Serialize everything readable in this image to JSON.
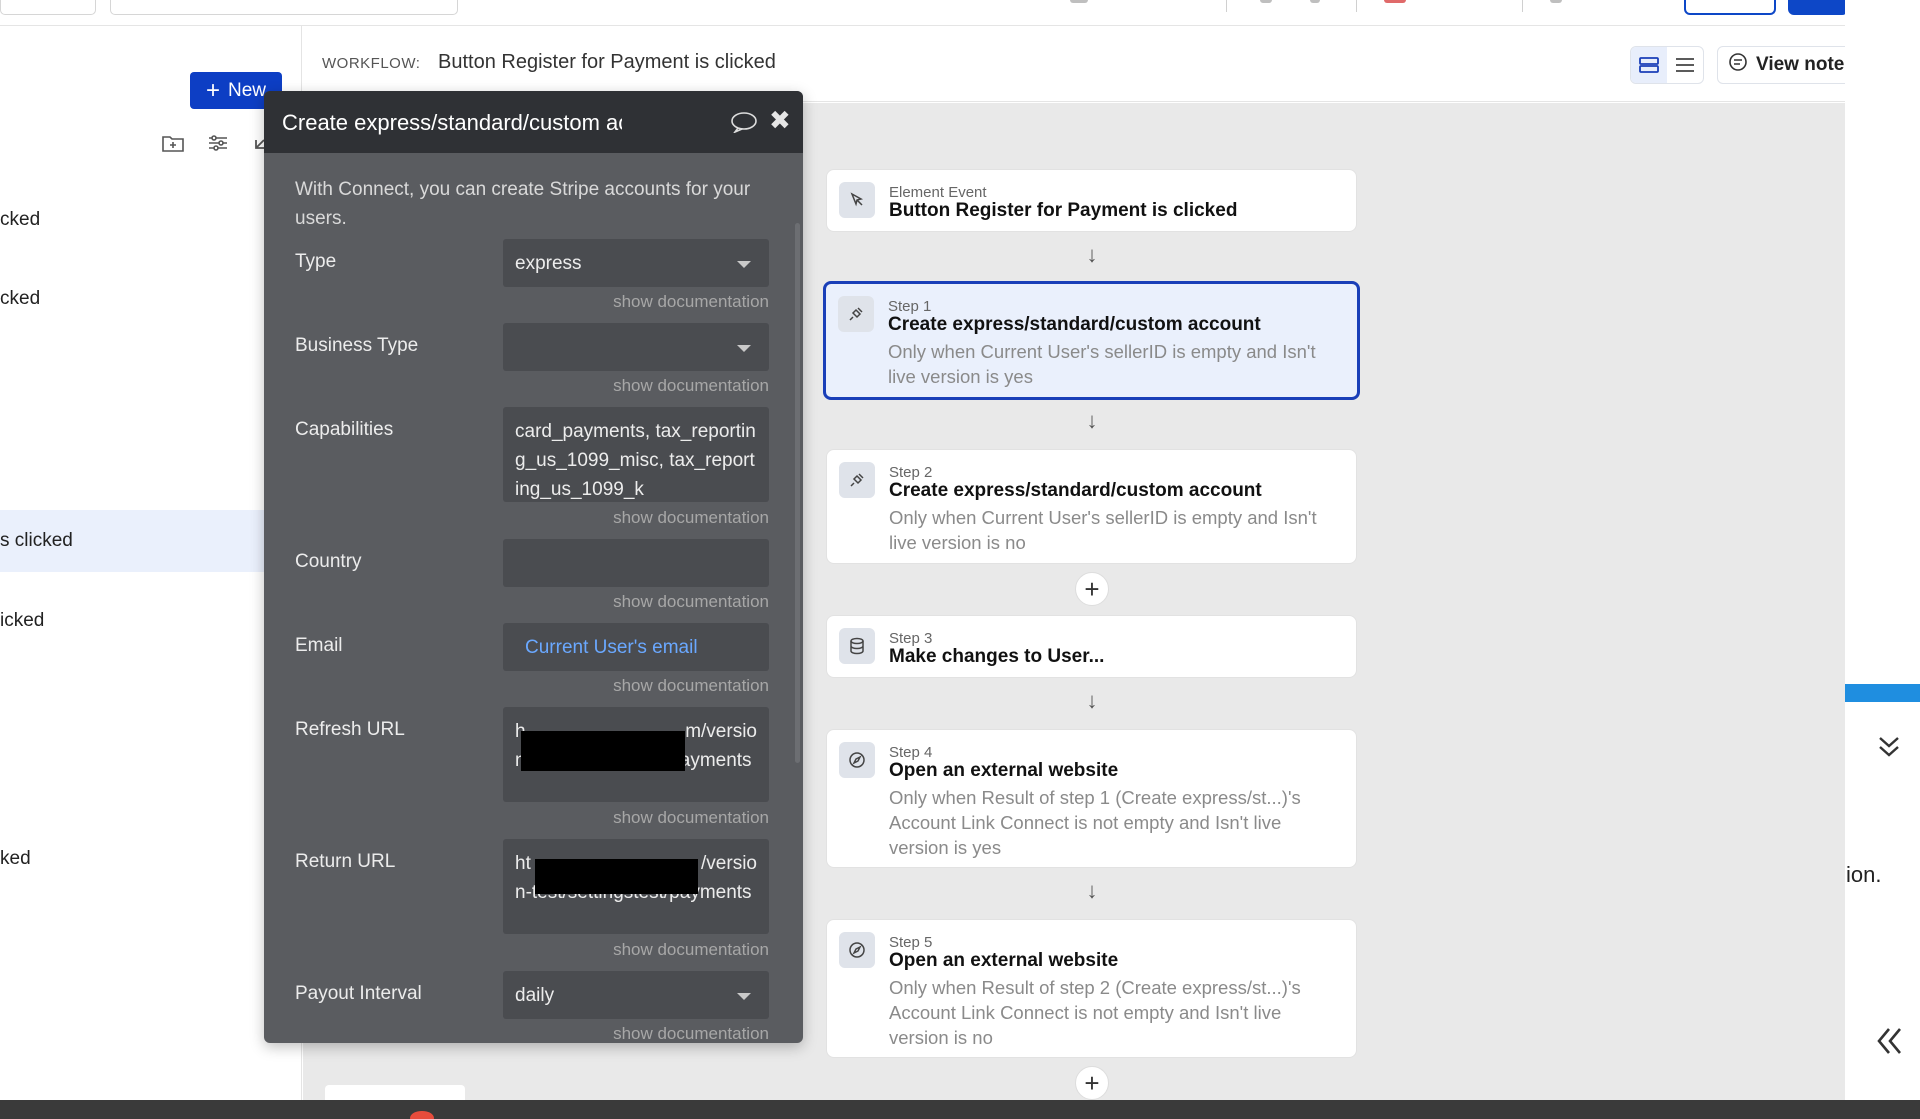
{
  "left_panel": {
    "new_button_label": "New",
    "items": [
      {
        "label": "cked"
      },
      {
        "label": "cked"
      },
      {
        "label": "s clicked"
      },
      {
        "label": "icked"
      },
      {
        "label": "ked"
      }
    ]
  },
  "header": {
    "workflow_label": "WORKFLOW:",
    "workflow_name": "Button Register for Payment is clicked",
    "view_notes_label": "View notes"
  },
  "editor": {
    "title": "Create express/standard/custom account",
    "description": "With Connect, you can create Stripe accounts for your users.",
    "doc_link": "show documentation",
    "fields": {
      "type": {
        "label": "Type",
        "value": "express"
      },
      "business_type": {
        "label": "Business Type",
        "value": ""
      },
      "capabilities": {
        "label": "Capabilities",
        "value": "card_payments, tax_reporting_us_1099_misc, tax_reporting_us_1099_k"
      },
      "country": {
        "label": "Country",
        "value": ""
      },
      "email": {
        "label": "Email",
        "value": "Current User's email"
      },
      "refresh_url": {
        "label": "Refresh URL",
        "prefix": "h",
        "suffix": "m/versio",
        "rest": "n-test/settingstest/payments"
      },
      "return_url": {
        "label": "Return URL",
        "prefix": "ht",
        "suffix": "/versio",
        "rest": "n-test/settingstest/payments"
      },
      "payout_interval": {
        "label": "Payout Interval",
        "value": "daily"
      }
    }
  },
  "steps": {
    "event": {
      "label": "Element Event",
      "title": "Button Register for Payment is clicked"
    },
    "step1": {
      "label": "Step 1",
      "title": "Create express/standard/custom account",
      "condition": "Only when Current User's sellerID is empty and Isn't live version is yes"
    },
    "step2": {
      "label": "Step 2",
      "title": "Create express/standard/custom account",
      "condition": "Only when Current User's sellerID is empty and Isn't live version is no"
    },
    "step3": {
      "label": "Step 3",
      "title": "Make changes to User..."
    },
    "step4": {
      "label": "Step 4",
      "title": "Open an external website",
      "condition": "Only when Result of step 1 (Create express/st...)'s Account Link Connect is not empty and Isn't live version is yes"
    },
    "step5": {
      "label": "Step 5",
      "title": "Open an external website",
      "condition": "Only when Result of step 2 (Create express/st...)'s Account Link Connect is not empty and Isn't live version is no"
    }
  },
  "right_strip": {
    "partial_text": "ion."
  },
  "icons": [
    "plus-icon",
    "folder-add-icon",
    "filter-icon",
    "collapse-icon",
    "comment-icon",
    "close-icon",
    "cursor-icon",
    "plug-icon",
    "database-icon",
    "compass-icon",
    "arrow-down-icon",
    "card-view-icon",
    "list-view-icon",
    "notes-icon",
    "chevrons-down-icon",
    "chevrons-left-icon"
  ],
  "colors": {
    "accent": "#0d3ec4",
    "selected_border": "#1a3fb8",
    "selected_bg": "#eaf0fc",
    "editor_bg": "#5a5c60",
    "editor_header": "#2f3135",
    "link": "#6aa8ff"
  }
}
